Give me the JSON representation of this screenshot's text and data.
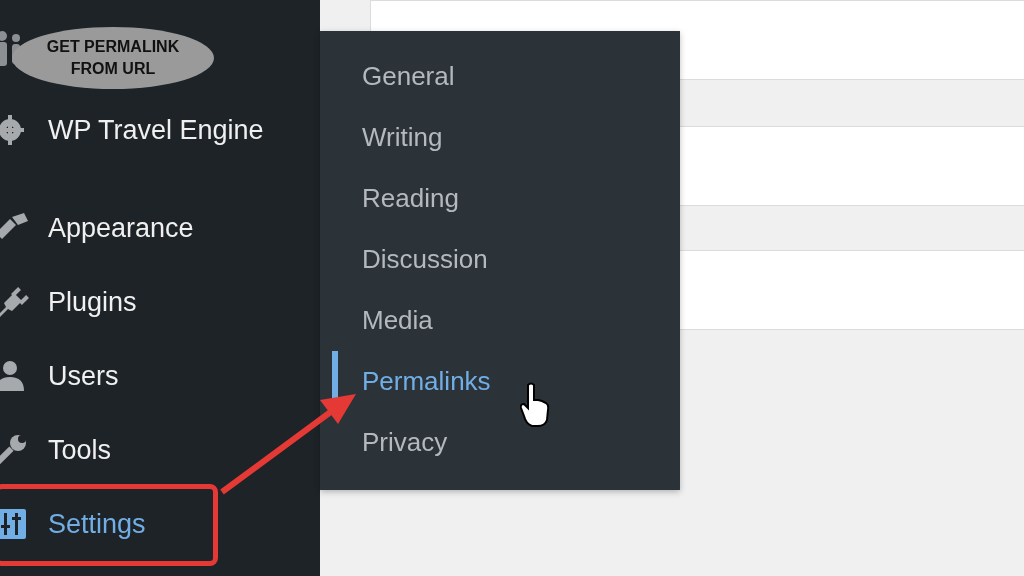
{
  "annotation": {
    "label": "GET PERMALINK FROM URL"
  },
  "sidebar": {
    "items": [
      {
        "label": "WP Travel Engine",
        "selected": false,
        "annotated": false
      },
      {
        "label": "Appearance",
        "selected": false,
        "annotated": false
      },
      {
        "label": "Plugins",
        "selected": false,
        "annotated": false
      },
      {
        "label": "Users",
        "selected": false,
        "annotated": false
      },
      {
        "label": "Tools",
        "selected": false,
        "annotated": false
      },
      {
        "label": "Settings",
        "selected": true,
        "annotated": true
      }
    ]
  },
  "submenu": {
    "items": [
      {
        "label": "General",
        "selected": false
      },
      {
        "label": "Writing",
        "selected": false
      },
      {
        "label": "Reading",
        "selected": false
      },
      {
        "label": "Discussion",
        "selected": false
      },
      {
        "label": "Media",
        "selected": false
      },
      {
        "label": "Permalinks",
        "selected": true
      },
      {
        "label": "Privacy",
        "selected": false
      }
    ]
  }
}
